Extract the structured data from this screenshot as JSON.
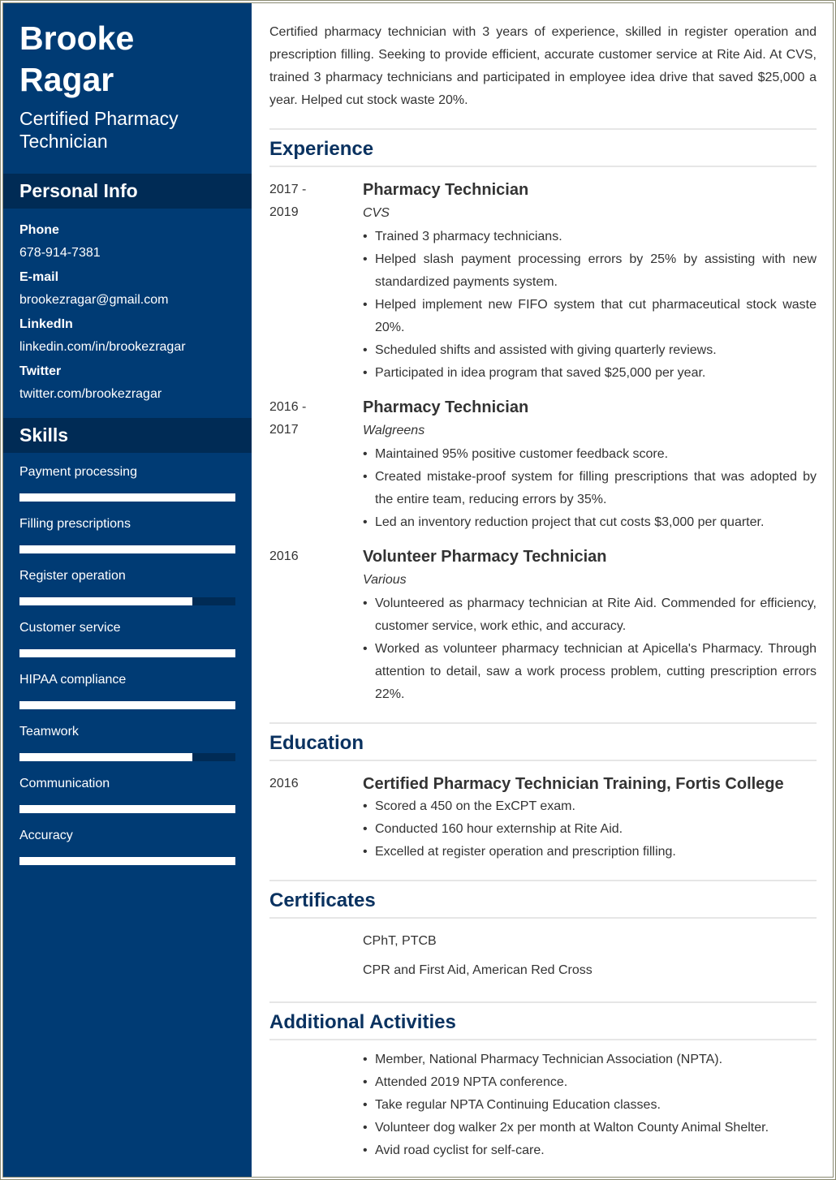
{
  "profile": {
    "first_name": "Brooke",
    "last_name": "Ragar",
    "title": "Certified Pharmacy Technician"
  },
  "personal_info": {
    "heading": "Personal Info",
    "fields": [
      {
        "label": "Phone",
        "value": "678-914-7381"
      },
      {
        "label": "E-mail",
        "value": "brookezragar@gmail.com"
      },
      {
        "label": "LinkedIn",
        "value": "linkedin.com/in/brookezragar"
      },
      {
        "label": "Twitter",
        "value": "twitter.com/brookezragar"
      }
    ]
  },
  "skills": {
    "heading": "Skills",
    "scale_max": 5,
    "items": [
      {
        "label": "Payment processing",
        "level": 5
      },
      {
        "label": "Filling prescriptions",
        "level": 5
      },
      {
        "label": "Register operation",
        "level": 4
      },
      {
        "label": "Customer service",
        "level": 5
      },
      {
        "label": "HIPAA compliance",
        "level": 5
      },
      {
        "label": "Teamwork",
        "level": 4
      },
      {
        "label": "Communication",
        "level": 5
      },
      {
        "label": "Accuracy",
        "level": 5
      }
    ]
  },
  "summary": "Certified pharmacy technician with 3 years of experience, skilled in register operation and prescription filling. Seeking to provide efficient, accurate customer service at Rite Aid. At CVS, trained 3 pharmacy technicians and participated in employee idea drive that saved $25,000 a year. Helped cut stock waste 20%.",
  "experience": {
    "heading": "Experience",
    "entries": [
      {
        "date_start": "2017 -",
        "date_end": "2019",
        "job_title": "Pharmacy Technician",
        "company": "CVS",
        "bullets": [
          "Trained 3 pharmacy technicians.",
          "Helped slash payment processing errors by 25% by assisting with new standardized payments system.",
          "Helped implement new FIFO system that cut pharmaceutical stock waste 20%.",
          "Scheduled shifts and assisted with giving quarterly reviews.",
          "Participated in idea program that saved $25,000 per year."
        ]
      },
      {
        "date_start": "2016 -",
        "date_end": "2017",
        "job_title": "Pharmacy Technician",
        "company": "Walgreens",
        "bullets": [
          "Maintained 95% positive customer feedback score.",
          "Created mistake-proof system for filling prescriptions that was adopted by the entire team, reducing errors by 35%.",
          "Led an inventory reduction project that cut costs $3,000 per quarter."
        ]
      },
      {
        "date_start": "2016",
        "date_end": "",
        "job_title": "Volunteer Pharmacy Technician",
        "company": "Various",
        "bullets": [
          "Volunteered as pharmacy technician at Rite Aid. Commended for efficiency, customer service, work ethic, and accuracy.",
          "Worked as volunteer pharmacy technician at Apicella's Pharmacy. Through attention to detail, saw a work process problem, cutting prescription errors 22%."
        ]
      }
    ]
  },
  "education": {
    "heading": "Education",
    "entries": [
      {
        "date": "2016",
        "degree": "Certified Pharmacy Technician Training, Fortis College",
        "bullets": [
          "Scored a 450 on the ExCPT exam.",
          "Conducted 160 hour externship at Rite Aid.",
          "Excelled at register operation and prescription filling."
        ]
      }
    ]
  },
  "certificates": {
    "heading": "Certificates",
    "items": [
      "CPhT, PTCB",
      "CPR and First Aid, American Red Cross"
    ]
  },
  "activities": {
    "heading": "Additional Activities",
    "items": [
      "Member, National Pharmacy Technician Association (NPTA).",
      "Attended 2019 NPTA conference.",
      "Take regular NPTA Continuing Education classes.",
      "Volunteer dog walker 2x per month at Walton County Animal Shelter.",
      "Avid road cyclist for self-care."
    ]
  },
  "colors": {
    "sidebar": "#003b74",
    "sidebar_header": "#002b55",
    "heading_text": "#0a3260",
    "body_text": "#333333",
    "divider": "#e6e6e6",
    "frame": "#8a8a72"
  }
}
